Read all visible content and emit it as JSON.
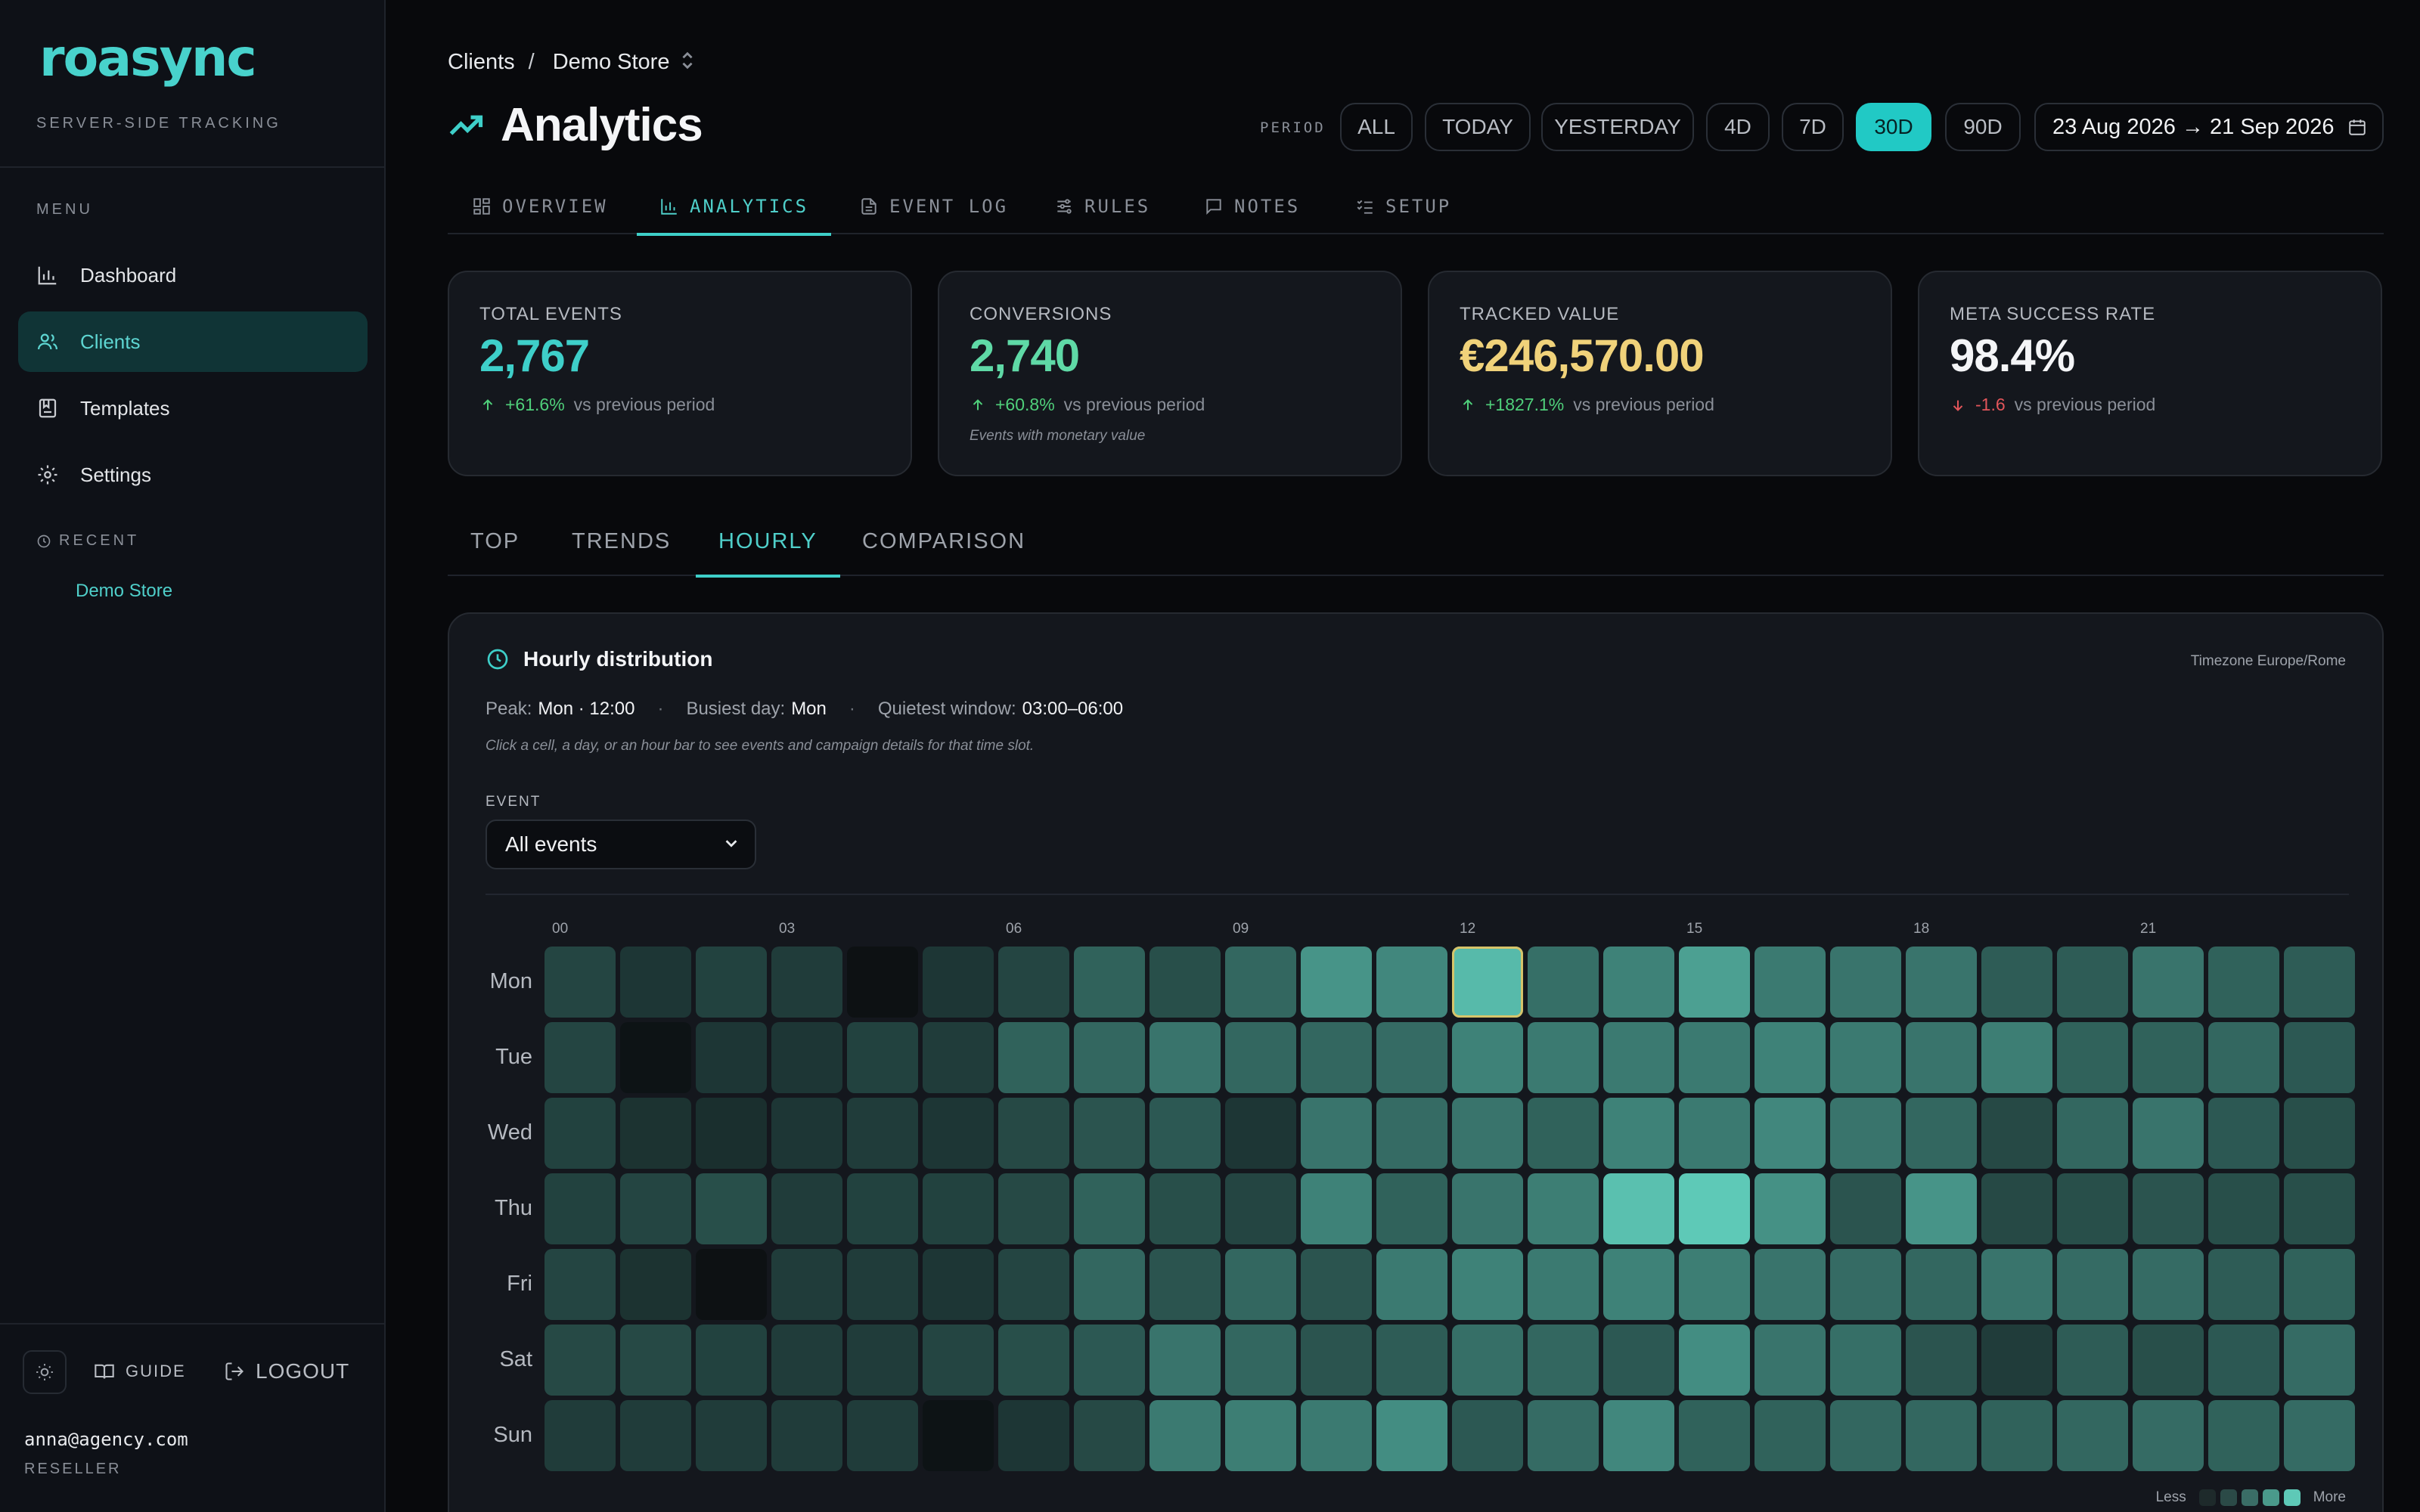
{
  "sidebar": {
    "logo": "roasync",
    "tagline": "SERVER-SIDE TRACKING",
    "menu_label": "MENU",
    "items": [
      {
        "label": "Dashboard",
        "icon": "bar-chart-icon"
      },
      {
        "label": "Clients",
        "icon": "users-icon",
        "active": true
      },
      {
        "label": "Templates",
        "icon": "template-icon"
      },
      {
        "label": "Settings",
        "icon": "gear-icon"
      }
    ],
    "recent_label": "RECENT",
    "recent_items": [
      "Demo Store"
    ],
    "guide_label": "GUIDE",
    "logout_label": "LOGOUT",
    "user_email": "anna@agency.com",
    "user_role": "RESELLER"
  },
  "header": {
    "breadcrumb_root": "Clients",
    "breadcrumb_sep": "/",
    "breadcrumb_current": "Demo Store",
    "title": "Analytics",
    "period_label": "PERIOD",
    "periods": [
      "ALL",
      "TODAY",
      "YESTERDAY",
      "4D",
      "7D",
      "30D",
      "90D"
    ],
    "active_period": "30D",
    "date_range": "23 Aug 2026 → 21 Sep 2026"
  },
  "tabs": [
    {
      "label": "OVERVIEW",
      "icon": "grid-icon"
    },
    {
      "label": "ANALYTICS",
      "icon": "bar-chart-icon",
      "active": true
    },
    {
      "label": "EVENT LOG",
      "icon": "document-icon"
    },
    {
      "label": "RULES",
      "icon": "sliders-icon"
    },
    {
      "label": "NOTES",
      "icon": "comment-icon"
    },
    {
      "label": "SETUP",
      "icon": "checklist-icon"
    }
  ],
  "kpis": [
    {
      "label": "TOTAL EVENTS",
      "value": "2,767",
      "delta": "+61.6%",
      "direction": "up",
      "suffix": "vs previous period",
      "color": "#3ecfc9"
    },
    {
      "label": "CONVERSIONS",
      "value": "2,740",
      "delta": "+60.8%",
      "direction": "up",
      "suffix": "vs previous period",
      "note": "Events with monetary value",
      "color": "#5fd9a6"
    },
    {
      "label": "TRACKED VALUE",
      "value": "€246,570.00",
      "delta": "+1827.1%",
      "direction": "up",
      "suffix": "vs previous period",
      "color": "#f0d27a"
    },
    {
      "label": "META SUCCESS RATE",
      "value": "98.4%",
      "delta": "-1.6",
      "direction": "down",
      "suffix": "vs previous period",
      "color": "#f4f5f7"
    }
  ],
  "subtabs": [
    "TOP",
    "TRENDS",
    "HOURLY",
    "COMPARISON"
  ],
  "active_subtab": "HOURLY",
  "panel": {
    "title": "Hourly distribution",
    "timezone": "Timezone Europe/Rome",
    "peak_label": "Peak:",
    "peak_value": "Mon · 12:00",
    "busiest_label": "Busiest day:",
    "busiest_value": "Mon",
    "quietest_label": "Quietest window:",
    "quietest_value": "03:00–06:00",
    "hint": "Click a cell, a day, or an hour bar to see events and campaign details for that time slot.",
    "event_label": "EVENT",
    "event_selected": "All events",
    "legend_less": "Less",
    "legend_more": "More"
  },
  "colors": {
    "accent": "#21c9c5",
    "heat_low": "#0b0d10",
    "heat_high": "#5ec9b7",
    "selected_outline": "#d6c46a"
  },
  "chart_data": {
    "type": "heatmap",
    "x_tick_labels": [
      "00",
      "03",
      "06",
      "09",
      "12",
      "15",
      "18",
      "21"
    ],
    "x": [
      0,
      1,
      2,
      3,
      4,
      5,
      6,
      7,
      8,
      9,
      10,
      11,
      12,
      13,
      14,
      15,
      16,
      17,
      18,
      19,
      20,
      21,
      22,
      23
    ],
    "y": [
      "Mon",
      "Tue",
      "Wed",
      "Thu",
      "Fri",
      "Sat",
      "Sun"
    ],
    "scale": "relative intensity 0-1",
    "values": [
      [
        0.3,
        0.22,
        0.28,
        0.25,
        0.02,
        0.22,
        0.3,
        0.45,
        0.35,
        0.48,
        0.72,
        0.65,
        0.92,
        0.52,
        0.62,
        0.78,
        0.58,
        0.55,
        0.55,
        0.42,
        0.42,
        0.55,
        0.45,
        0.42
      ],
      [
        0.3,
        0.03,
        0.22,
        0.22,
        0.28,
        0.25,
        0.45,
        0.48,
        0.55,
        0.48,
        0.48,
        0.5,
        0.62,
        0.58,
        0.58,
        0.58,
        0.62,
        0.58,
        0.55,
        0.6,
        0.45,
        0.45,
        0.48,
        0.4
      ],
      [
        0.28,
        0.2,
        0.18,
        0.22,
        0.25,
        0.22,
        0.32,
        0.38,
        0.4,
        0.22,
        0.55,
        0.5,
        0.55,
        0.45,
        0.62,
        0.58,
        0.65,
        0.55,
        0.48,
        0.32,
        0.48,
        0.55,
        0.4,
        0.35
      ],
      [
        0.28,
        0.3,
        0.35,
        0.25,
        0.28,
        0.28,
        0.32,
        0.45,
        0.35,
        0.3,
        0.62,
        0.45,
        0.55,
        0.6,
        0.95,
        1.0,
        0.7,
        0.38,
        0.72,
        0.32,
        0.35,
        0.38,
        0.35,
        0.35
      ],
      [
        0.3,
        0.2,
        0.02,
        0.25,
        0.25,
        0.22,
        0.3,
        0.48,
        0.38,
        0.48,
        0.38,
        0.58,
        0.62,
        0.58,
        0.62,
        0.6,
        0.55,
        0.5,
        0.48,
        0.55,
        0.5,
        0.5,
        0.42,
        0.45
      ],
      [
        0.32,
        0.32,
        0.28,
        0.25,
        0.25,
        0.3,
        0.35,
        0.4,
        0.55,
        0.48,
        0.38,
        0.42,
        0.52,
        0.48,
        0.4,
        0.68,
        0.55,
        0.52,
        0.38,
        0.25,
        0.42,
        0.35,
        0.4,
        0.5
      ],
      [
        0.25,
        0.25,
        0.25,
        0.25,
        0.25,
        0.03,
        0.22,
        0.32,
        0.58,
        0.6,
        0.58,
        0.68,
        0.4,
        0.5,
        0.65,
        0.45,
        0.45,
        0.48,
        0.48,
        0.45,
        0.48,
        0.5,
        0.45,
        0.5
      ]
    ],
    "peak_cell": {
      "day": "Mon",
      "hour": 12
    }
  }
}
